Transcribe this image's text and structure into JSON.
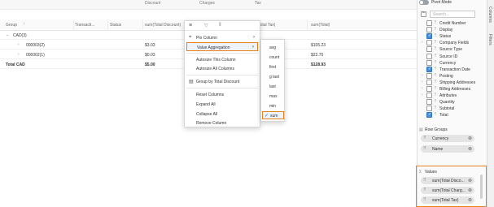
{
  "grid": {
    "top_groups": [
      "Discount",
      "Charges",
      "Tax"
    ],
    "headers": [
      "Group",
      "Transacti...",
      "Status",
      "sum(Total Discount)",
      "sum(Total Tax)",
      "sum(Total)"
    ],
    "sort_icon": "sort-asc-icon",
    "rows": [
      {
        "label": "CAD(3)",
        "indent": 0,
        "expand": "⌄",
        "discount": "",
        "tax": "",
        "total": ""
      },
      {
        "label": "000003(2)",
        "indent": 1,
        "expand": "›",
        "discount": "$3.03",
        "tax": "",
        "total": "$105.23"
      },
      {
        "label": "000002(1)",
        "indent": 1,
        "expand": "›",
        "discount": "$0.03",
        "tax": "",
        "total": "$23.70"
      },
      {
        "label": "Total CAD",
        "indent": 0,
        "expand": "",
        "discount": "$5.00",
        "tax": "",
        "total": "$128.93"
      }
    ]
  },
  "column_menu": {
    "tab_icons": [
      "menu-lines-icon",
      "filter-icon",
      "columns-icon"
    ],
    "items": [
      {
        "label": "Pin Column",
        "icon": "pin-icon",
        "submenu": true
      },
      {
        "label": "Value Aggregation",
        "icon": "",
        "submenu": true,
        "highlighted": true
      },
      {
        "label": "Autosize This Column",
        "icon": ""
      },
      {
        "label": "Autosize All Columns",
        "icon": ""
      },
      {
        "label": "Group by Total Discount",
        "icon": "group-icon"
      },
      {
        "label": "Reset Columns",
        "icon": ""
      },
      {
        "label": "Expand All",
        "icon": ""
      },
      {
        "label": "Collapse All",
        "icon": ""
      },
      {
        "label": "Remove Column",
        "icon": ""
      }
    ]
  },
  "aggregation_menu": {
    "items": [
      {
        "label": "avg",
        "checked": false
      },
      {
        "label": "count",
        "checked": false
      },
      {
        "label": "first",
        "checked": false
      },
      {
        "label": "g last",
        "checked": false
      },
      {
        "label": "last",
        "checked": false
      },
      {
        "label": "max",
        "checked": false
      },
      {
        "label": "min",
        "checked": false
      },
      {
        "label": "sum",
        "checked": true
      }
    ]
  },
  "tool_panel": {
    "pivot_mode_label": "Pivot Mode",
    "search_placeholder": "Search...",
    "columns": [
      {
        "label": "Credit Number",
        "checked": false
      },
      {
        "label": "Display",
        "checked": false
      },
      {
        "label": "Status",
        "checked": true
      },
      {
        "label": "Company Fields",
        "checked": false,
        "group": true
      },
      {
        "label": "Source Type",
        "checked": false
      },
      {
        "label": "Source ID",
        "checked": false
      },
      {
        "label": "Currency",
        "checked": false
      },
      {
        "label": "Transaction Date",
        "checked": true
      },
      {
        "label": "Posting",
        "checked": false,
        "group": true
      },
      {
        "label": "Shipping Addresses",
        "checked": false,
        "group": true
      },
      {
        "label": "Billing Addresses",
        "checked": false,
        "group": true
      },
      {
        "label": "Attributes",
        "checked": false,
        "group": true
      },
      {
        "label": "Quantity",
        "checked": false
      },
      {
        "label": "Subtotal",
        "checked": false
      },
      {
        "label": "Total",
        "checked": true
      }
    ],
    "row_groups_label": "Row Groups",
    "row_groups": [
      "Currency",
      "Name"
    ],
    "values_label": "Values",
    "values": [
      "sum(Total Disco...",
      "sum(Total Charg...",
      "sum(Total Tax)"
    ]
  },
  "side_tabs": [
    "Columns",
    "Filters"
  ],
  "colors": {
    "accent": "#e8821e",
    "checkbox": "#4a90d9",
    "chip": "#e4e4e4"
  }
}
